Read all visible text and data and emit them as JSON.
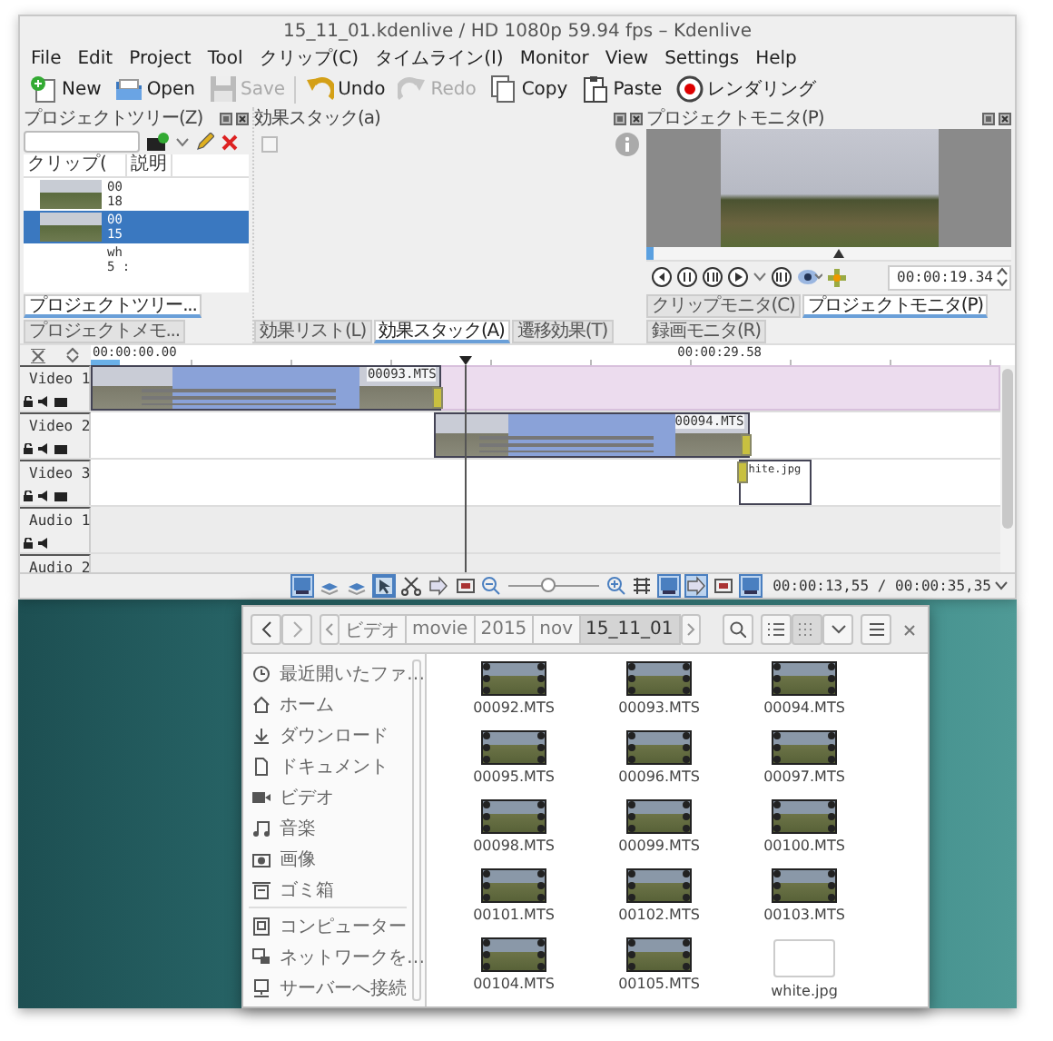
{
  "window": {
    "title": "15_11_01.kdenlive / HD 1080p 59.94 fps – Kdenlive"
  },
  "menu": [
    "File",
    "Edit",
    "Project",
    "Tool",
    "クリップ(C)",
    "タイムライン(I)",
    "Monitor",
    "View",
    "Settings",
    "Help"
  ],
  "toolbar": [
    {
      "label": "New",
      "kind": "new",
      "disabled": false,
      "separator_before": false
    },
    {
      "label": "Open",
      "kind": "open",
      "disabled": false,
      "separator_before": false
    },
    {
      "label": "Save",
      "kind": "save",
      "disabled": true,
      "separator_before": false
    },
    {
      "label": "Undo",
      "kind": "undo",
      "disabled": false,
      "separator_before": true
    },
    {
      "label": "Redo",
      "kind": "redo",
      "disabled": true,
      "separator_before": false
    },
    {
      "label": "Copy",
      "kind": "copy",
      "disabled": false,
      "separator_before": false
    },
    {
      "label": "Paste",
      "kind": "paste",
      "disabled": false,
      "separator_before": false
    },
    {
      "label": "レンダリング",
      "kind": "render",
      "disabled": false,
      "separator_before": false
    }
  ],
  "project_tree": {
    "title": "プロジェクトツリー(Z)",
    "columns": [
      "クリップ(",
      "説明"
    ],
    "clips": [
      {
        "name": "00",
        "line2": "18",
        "kind": "video",
        "selected": false
      },
      {
        "name": "00",
        "line2": "15",
        "kind": "video",
        "selected": true
      },
      {
        "name": "wh",
        "line2": "5 :",
        "kind": "image",
        "selected": false
      }
    ],
    "tabs": [
      {
        "label": "プロジェクトツリー...",
        "selected": true
      },
      {
        "label": "プロジェクトメモ...",
        "selected": false
      }
    ]
  },
  "effect_stack": {
    "title": "効果スタック(a)",
    "enabled": {
      "checked": false
    },
    "tabs": [
      {
        "label": "効果リスト(L)",
        "selected": false
      },
      {
        "label": "効果スタック(A)",
        "selected": true
      },
      {
        "label": "遷移効果(T)",
        "selected": false
      }
    ]
  },
  "monitor": {
    "title": "プロジェクトモニタ(P)",
    "timecode": "00:00:19.34",
    "tabs": [
      {
        "label": "クリップモニタ(C)",
        "selected": false
      },
      {
        "label": "プロジェクトモニタ(P)",
        "selected": true
      },
      {
        "label": "録画モニタ(R)",
        "selected": false
      }
    ]
  },
  "timeline": {
    "ruler": [
      "00:00:00.00",
      "00:00:29.58"
    ],
    "tracks": [
      {
        "name": "Video 1",
        "kind": "video",
        "selected": true,
        "clips": [
          {
            "name": "00093.MTS",
            "kind": "video"
          }
        ]
      },
      {
        "name": "Video 2",
        "kind": "video",
        "selected": false,
        "clips": [
          {
            "name": "00094.MTS",
            "kind": "video"
          }
        ]
      },
      {
        "name": "Video 3",
        "kind": "video",
        "selected": false,
        "clips": [
          {
            "name": "hite.jpg",
            "kind": "image"
          }
        ]
      },
      {
        "name": "Audio 1",
        "kind": "audio",
        "selected": false
      },
      {
        "name": "Audio 2",
        "kind": "audio",
        "selected": false
      }
    ],
    "tools_left": [
      {
        "kind": "screen",
        "on": true
      },
      {
        "kind": "layers",
        "on": false
      },
      {
        "kind": "layers",
        "on": false
      },
      {
        "kind": "cursor",
        "on": true
      },
      {
        "kind": "scissors",
        "on": false
      },
      {
        "kind": "arrow",
        "on": false
      },
      {
        "kind": "frame",
        "on": false
      }
    ],
    "zoom": {
      "level": 0.45
    },
    "tools_right": [
      {
        "kind": "grid",
        "on": false
      },
      {
        "kind": "screen",
        "on": true
      },
      {
        "kind": "arrow",
        "on": true
      },
      {
        "kind": "frame",
        "on": false
      },
      {
        "kind": "screen",
        "on": true
      }
    ],
    "timecode": "00:00:13,55 / 00:00:35,35"
  },
  "file_manager": {
    "path": [
      {
        "label": "ビデオ",
        "selected": false
      },
      {
        "label": "movie",
        "selected": false
      },
      {
        "label": "2015",
        "selected": false
      },
      {
        "label": "nov",
        "selected": false
      },
      {
        "label": "15_11_01",
        "selected": true
      }
    ],
    "view_modes": [
      {
        "kind": "list",
        "selected": false
      },
      {
        "kind": "grid",
        "selected": true
      }
    ],
    "places": [
      {
        "label": "最近開いたファ…",
        "kind": "clock",
        "separator_before": false
      },
      {
        "label": "ホーム",
        "kind": "home",
        "separator_before": false
      },
      {
        "label": "ダウンロード",
        "kind": "download",
        "separator_before": false
      },
      {
        "label": "ドキュメント",
        "kind": "document",
        "separator_before": false
      },
      {
        "label": "ビデオ",
        "kind": "camera",
        "separator_before": false
      },
      {
        "label": "音楽",
        "kind": "music",
        "separator_before": false
      },
      {
        "label": "画像",
        "kind": "photo",
        "separator_before": false
      },
      {
        "label": "ゴミ箱",
        "kind": "trash",
        "separator_before": false
      },
      {
        "label": "コンピューター",
        "kind": "computer",
        "separator_before": true
      },
      {
        "label": "ネットワークを…",
        "kind": "network",
        "separator_before": false
      },
      {
        "label": "サーバーへ接続",
        "kind": "server",
        "separator_before": false
      }
    ],
    "files": [
      {
        "name": "00092.MTS",
        "kind": "video"
      },
      {
        "name": "00093.MTS",
        "kind": "video"
      },
      {
        "name": "00094.MTS",
        "kind": "video"
      },
      {
        "name": "00095.MTS",
        "kind": "video"
      },
      {
        "name": "00096.MTS",
        "kind": "video"
      },
      {
        "name": "00097.MTS",
        "kind": "video"
      },
      {
        "name": "00098.MTS",
        "kind": "video"
      },
      {
        "name": "00099.MTS",
        "kind": "video"
      },
      {
        "name": "00100.MTS",
        "kind": "video"
      },
      {
        "name": "00101.MTS",
        "kind": "video"
      },
      {
        "name": "00102.MTS",
        "kind": "video"
      },
      {
        "name": "00103.MTS",
        "kind": "video"
      },
      {
        "name": "00104.MTS",
        "kind": "video"
      },
      {
        "name": "00105.MTS",
        "kind": "video"
      },
      {
        "name": "white.jpg",
        "kind": "image"
      }
    ]
  }
}
